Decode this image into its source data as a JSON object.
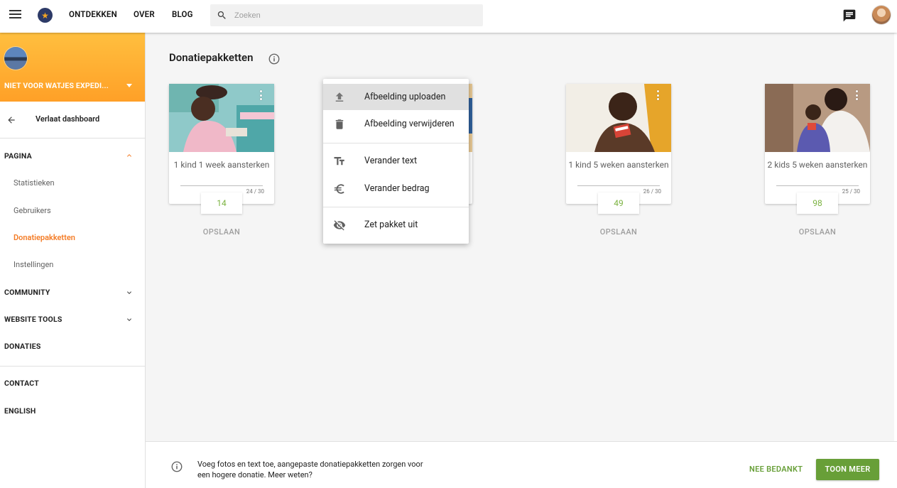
{
  "topbar": {
    "nav": [
      "ONTDEKKEN",
      "OVER",
      "BLOG"
    ],
    "search_placeholder": "Zoeken"
  },
  "sidebar": {
    "campaign_title": "NIET VOOR WATJES EXPEDI...",
    "back_label": "Verlaat dashboard",
    "section_pagina": "PAGINA",
    "pagina_items": [
      "Statistieken",
      "Gebruikers",
      "Donatiepakketten",
      "Instellingen"
    ],
    "active_item": "Donatiepakketten",
    "section_community": "COMMUNITY",
    "section_website_tools": "WEBSITE TOOLS",
    "section_donaties": "DONATIES",
    "link_contact": "CONTACT",
    "link_english": "ENGLISH"
  },
  "main": {
    "title": "Donatiepakketten",
    "cards": [
      {
        "title": "1 kind 1 week aansterken",
        "count": "24 / 30",
        "amount": "14",
        "save_label": "OPSLAAN"
      },
      {
        "title": "",
        "count": "",
        "amount": "",
        "save_label": ""
      },
      {
        "title": "1 kind 5 weken aansterken",
        "count": "26 / 30",
        "amount": "49",
        "save_label": "OPSLAAN"
      },
      {
        "title": "2 kids 5 weken aansterken",
        "count": "25 / 30",
        "amount": "98",
        "save_label": "OPSLAAN"
      }
    ],
    "menu": {
      "items": [
        {
          "label": "Afbeelding uploaden",
          "icon": "upload-icon"
        },
        {
          "label": "Afbeelding verwijderen",
          "icon": "trash-icon"
        },
        {
          "label": "Verander text",
          "icon": "text-size-icon"
        },
        {
          "label": "Verander bedrag",
          "icon": "euro-icon"
        },
        {
          "label": "Zet pakket uit",
          "icon": "eye-off-icon"
        }
      ]
    }
  },
  "bottombar": {
    "message": "Voeg fotos en text toe, aangepaste donatiepakketten zorgen voor een hogere donatie. Meer weten?",
    "decline_label": "NEE BEDANKT",
    "primary_label": "TOON MEER"
  },
  "colors": {
    "accent_orange": "#ffa027",
    "active_text": "#f47c26",
    "green": "#689f38",
    "amount_green": "#7cb342"
  }
}
